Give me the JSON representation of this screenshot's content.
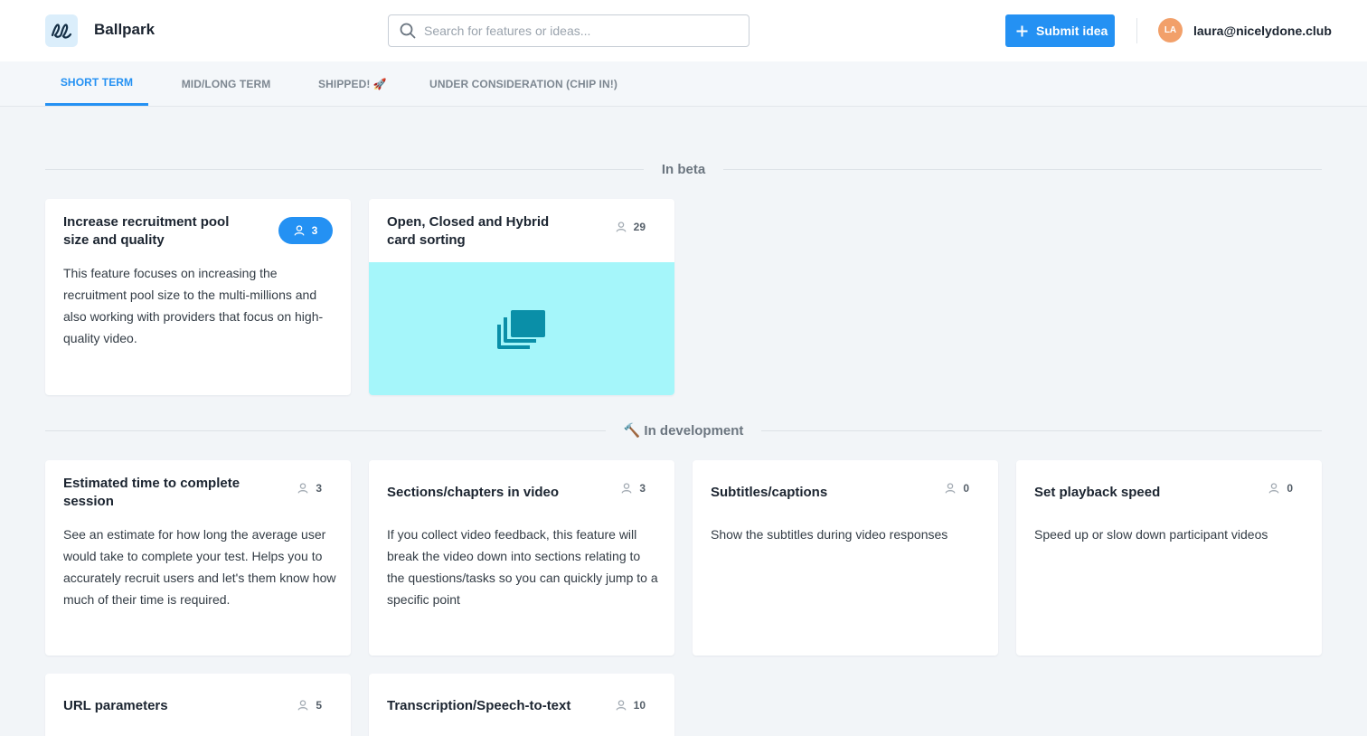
{
  "header": {
    "logo_text": "el",
    "app_name": "Ballpark",
    "search_placeholder": "Search for features or ideas...",
    "submit_label": "Submit idea",
    "avatar_initials": "LA",
    "user_email": "laura@nicelydone.club"
  },
  "tabs": [
    {
      "label": "SHORT TERM",
      "active": true
    },
    {
      "label": "MID/LONG TERM",
      "active": false
    },
    {
      "label": "SHIPPED! 🚀",
      "active": false
    },
    {
      "label": "UNDER CONSIDERATION (CHIP IN!)",
      "active": false
    }
  ],
  "sections": {
    "beta": {
      "title": "In beta"
    },
    "development": {
      "title": "🔨 In development"
    }
  },
  "cards": {
    "recruitment": {
      "title": "Increase recruitment pool size and quality",
      "votes": "3",
      "voted": true,
      "description": "This feature focuses on increasing the recruitment pool size to the multi-millions and also working with providers that focus on high-quality video."
    },
    "card_sorting": {
      "title": "Open, Closed and Hybrid card sorting",
      "votes": "29",
      "image_icon": "cards-stack-icon"
    },
    "estimated_time": {
      "title": "Estimated time to complete session",
      "votes": "3",
      "description": "See an estimate for how long the average user would take to complete your test. Helps you to accurately recruit users and let's them know how much of their time is required."
    },
    "sections_chapters": {
      "title": "Sections/chapters in video",
      "votes": "3",
      "description": "If you collect video feedback, this feature will break the video down into sections relating to the questions/tasks so you can quickly jump to a specific point"
    },
    "subtitles": {
      "title": "Subtitles/captions",
      "votes": "0",
      "description": "Show the subtitles during video responses"
    },
    "playback_speed": {
      "title": "Set playback speed",
      "votes": "0",
      "description": "Speed up or slow down participant videos"
    },
    "url_parameters": {
      "title": "URL parameters",
      "votes": "5"
    },
    "transcription": {
      "title": "Transcription/Speech-to-text",
      "votes": "10"
    }
  },
  "colors": {
    "accent": "#2491f3",
    "image_bg": "#a5f6fa",
    "image_icon": "#0a8fa8",
    "avatar": "#f2a06a"
  }
}
